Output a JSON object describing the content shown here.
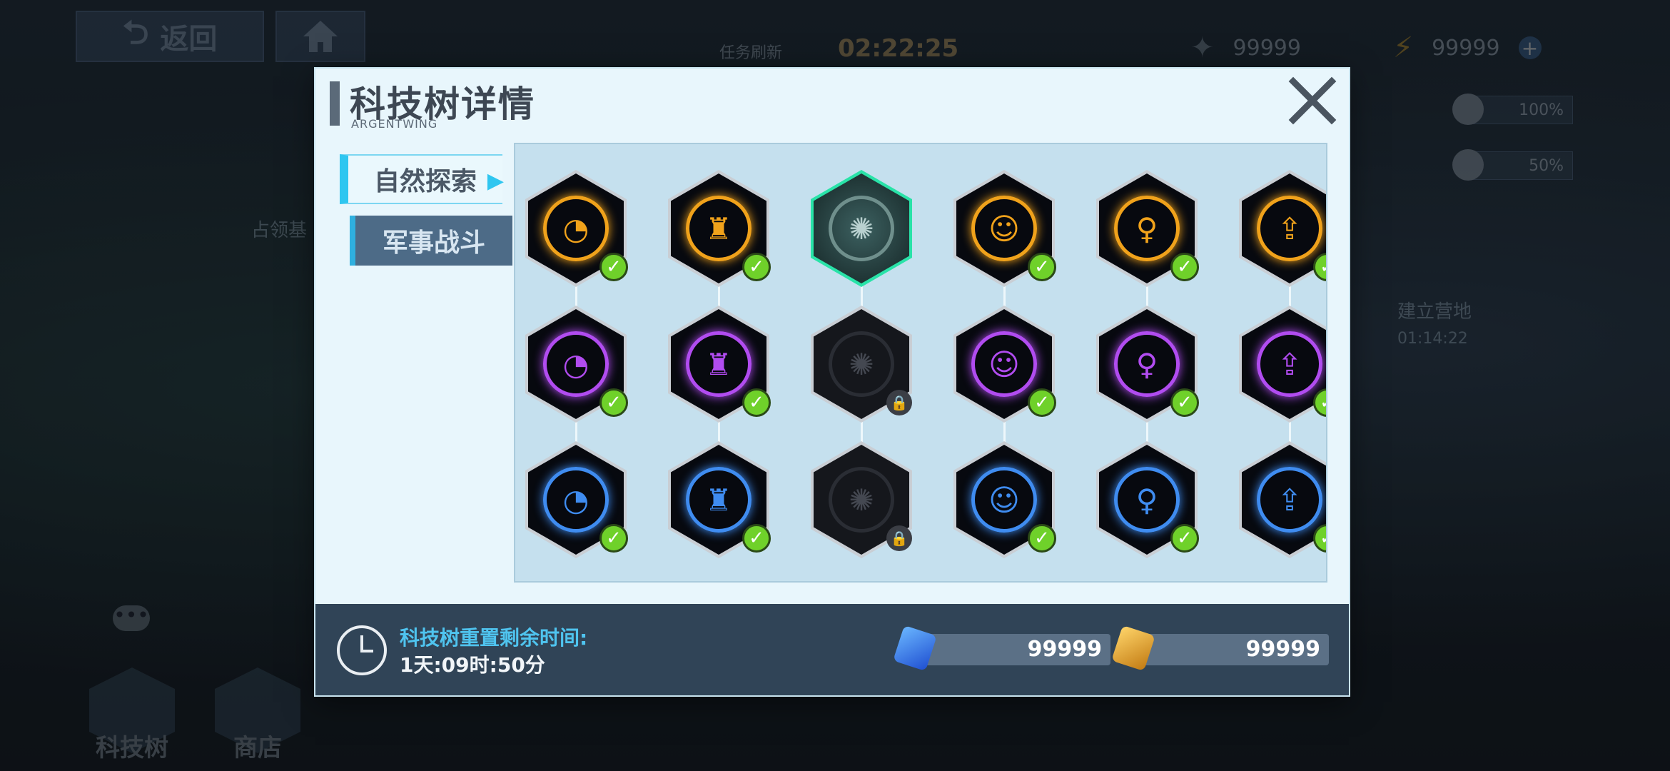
{
  "top_bar": {
    "back_label": "返回",
    "refresh_label": "任务刷新",
    "refresh_time": "02:22:25",
    "resource_1": "99999",
    "resource_2": "99999",
    "pct_1": "100%",
    "pct_2": "50%"
  },
  "map": {
    "label_1": "占领基",
    "label_2": "建立营地",
    "label_2_time": "01:14:22"
  },
  "bottom_nav": {
    "tech_label": "科技树",
    "shop_label": "商店"
  },
  "dialog": {
    "title": "科技树详情",
    "subtitle": "ARGENTWING",
    "tabs": [
      "自然探索",
      "军事战斗"
    ],
    "rows": [
      {
        "color": "#f0a21b",
        "nodes": [
          {
            "icon": "radar-icon",
            "state": "done"
          },
          {
            "icon": "mech-icon",
            "state": "done"
          },
          {
            "icon": "galaxy-icon",
            "state": "selected"
          },
          {
            "icon": "pilot-icon",
            "state": "done"
          },
          {
            "icon": "girl-icon",
            "state": "done"
          },
          {
            "icon": "upgrade-icon",
            "state": "done"
          }
        ]
      },
      {
        "color": "#b14cf0",
        "nodes": [
          {
            "icon": "radar-icon",
            "state": "done"
          },
          {
            "icon": "mech-icon",
            "state": "done"
          },
          {
            "icon": "galaxy-icon",
            "state": "locked"
          },
          {
            "icon": "pilot-icon",
            "state": "done"
          },
          {
            "icon": "girl-icon",
            "state": "done"
          },
          {
            "icon": "upgrade-icon",
            "state": "done"
          }
        ]
      },
      {
        "color": "#3f8cf0",
        "nodes": [
          {
            "icon": "radar-icon",
            "state": "done"
          },
          {
            "icon": "mech-icon",
            "state": "done"
          },
          {
            "icon": "galaxy-icon",
            "state": "locked"
          },
          {
            "icon": "pilot-icon",
            "state": "done"
          },
          {
            "icon": "girl-icon",
            "state": "done"
          },
          {
            "icon": "upgrade-icon",
            "state": "done"
          }
        ]
      }
    ],
    "reset_label": "科技树重置剩余时间:",
    "reset_value": "1天:09时:50分",
    "currency_blue": "99999",
    "currency_gold": "99999"
  }
}
